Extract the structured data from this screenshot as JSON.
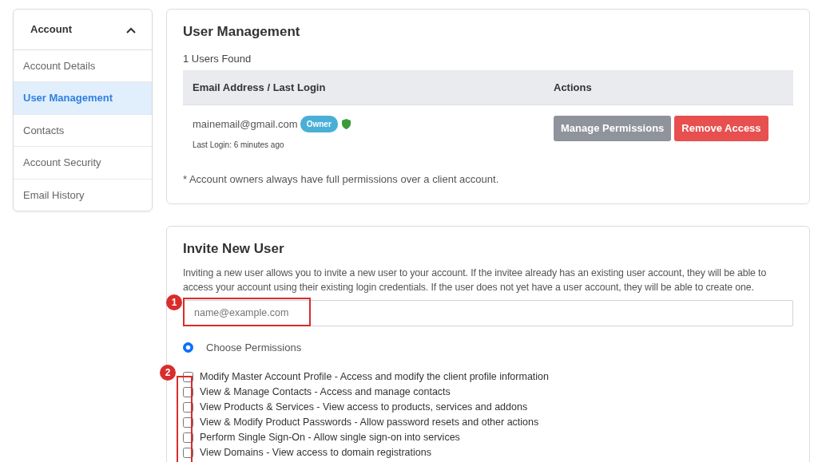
{
  "sidebar": {
    "title": "Account",
    "expanded": true,
    "items": [
      {
        "label": "Account Details",
        "selected": false
      },
      {
        "label": "User Management",
        "selected": true
      },
      {
        "label": "Contacts",
        "selected": false
      },
      {
        "label": "Account Security",
        "selected": false
      },
      {
        "label": "Email History",
        "selected": false
      }
    ]
  },
  "user_management": {
    "title": "User Management",
    "count": "1 Users Found",
    "columns": [
      "Email Address / Last Login",
      "Actions"
    ],
    "rows": [
      {
        "email": "mainemail@gmail.com",
        "badge": "Owner",
        "last_login": "Last Login: 6 minutes ago",
        "actions": [
          "Manage Permissions",
          "Remove Access"
        ]
      }
    ],
    "note": "* Account owners always have full permissions over a client account."
  },
  "invite": {
    "title": "Invite New User",
    "description": "Inviting a new user allows you to invite a new user to your account. If the invitee already has an existing user account, they will be able to access your account using their existing login credentials. If the user does not yet have a user account, they will be able to create one.",
    "email": {
      "placeholder": "name@example.com",
      "callout": "1"
    },
    "permissions_option": {
      "label": "Choose Permissions",
      "selected": true
    },
    "permissions_callout": "2",
    "permissions": [
      {
        "label": "Modify Master Account Profile - Access and modify the client profile information",
        "checked": false
      },
      {
        "label": "View & Manage Contacts - Access and manage contacts",
        "checked": false
      },
      {
        "label": "View Products & Services - View access to products, services and addons",
        "checked": false
      },
      {
        "label": "View & Modify Product Passwords - Allow password resets and other actions",
        "checked": false
      },
      {
        "label": "Perform Single Sign-On - Allow single sign-on into services",
        "checked": false
      },
      {
        "label": "View Domains - View access to domain registrations",
        "checked": false
      }
    ]
  }
}
